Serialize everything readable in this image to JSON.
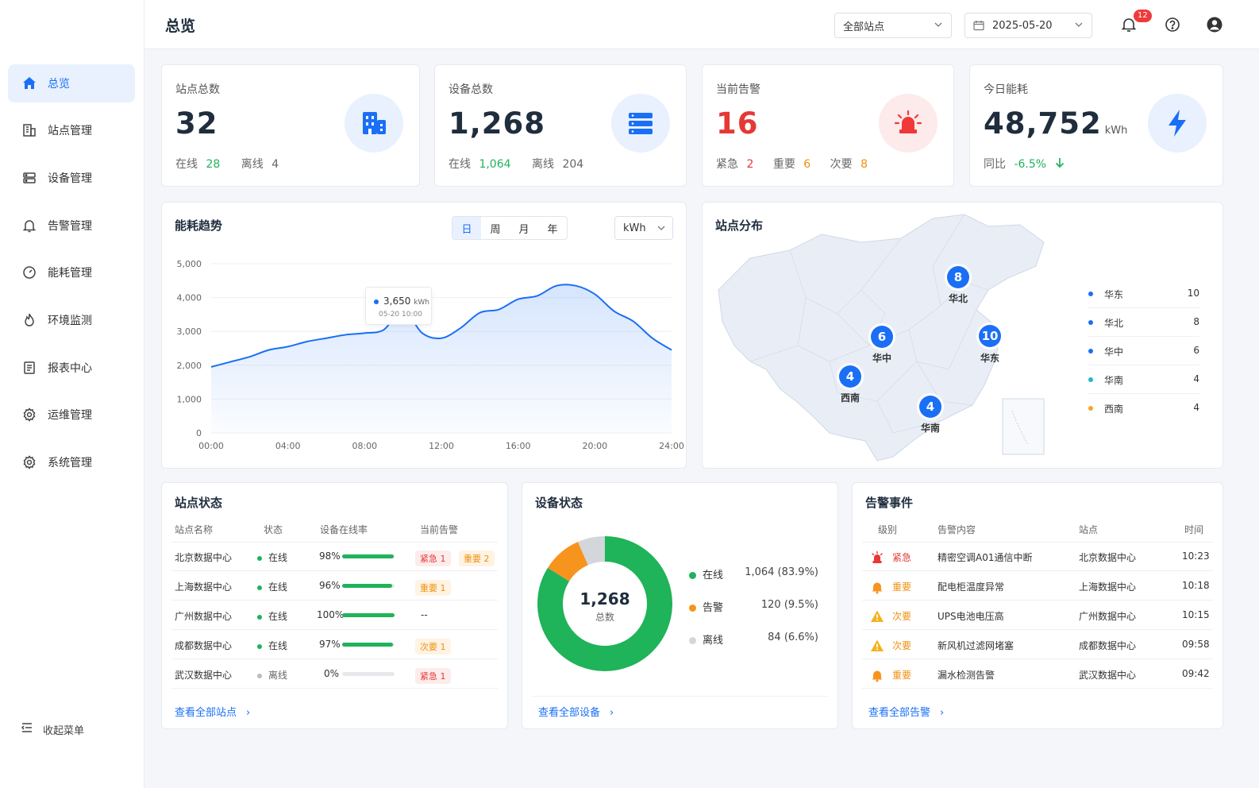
{
  "nav": {
    "items": [
      {
        "label": "总览",
        "icon": "home-icon"
      },
      {
        "label": "站点管理",
        "icon": "building-icon"
      },
      {
        "label": "设备管理",
        "icon": "server-icon"
      },
      {
        "label": "告警管理",
        "icon": "bell-icon"
      },
      {
        "label": "能耗管理",
        "icon": "gauge-icon"
      },
      {
        "label": "环境监测",
        "icon": "flame-icon"
      },
      {
        "label": "报表中心",
        "icon": "report-icon"
      },
      {
        "label": "运维管理",
        "icon": "settings-icon"
      },
      {
        "label": "系统管理",
        "icon": "settings-icon"
      }
    ],
    "collapse_label": "收起菜单"
  },
  "header": {
    "title": "总览",
    "site_select": "全部站点",
    "date": "2025-05-20",
    "notification_count": "12"
  },
  "stats": {
    "sites": {
      "label": "站点总数",
      "value": "32",
      "online_label": "在线",
      "online": "28",
      "offline_label": "离线",
      "offline": "4"
    },
    "devices": {
      "label": "设备总数",
      "value": "1,268",
      "online_label": "在线",
      "online": "1,064",
      "offline_label": "离线",
      "offline": "204"
    },
    "alarms": {
      "label": "当前告警",
      "value": "16",
      "urgent_label": "紧急",
      "urgent": "2",
      "major_label": "重要",
      "major": "6",
      "minor_label": "次要",
      "minor": "8"
    },
    "energy": {
      "label": "今日能耗",
      "value": "48,752",
      "unit": "kWh",
      "yoy_label": "同比",
      "yoy": "-6.5%"
    }
  },
  "energy_trend": {
    "title": "能耗趋势",
    "tabs": [
      "日",
      "周",
      "月",
      "年"
    ],
    "unit_select": "kWh",
    "tooltip_value": "3,650",
    "tooltip_unit": "kWh",
    "tooltip_time": "05-20 10:00"
  },
  "chart_data": {
    "type": "area",
    "x": [
      "00:00",
      "01:00",
      "02:00",
      "03:00",
      "04:00",
      "05:00",
      "06:00",
      "07:00",
      "08:00",
      "09:00",
      "10:00",
      "11:00",
      "12:00",
      "13:00",
      "14:00",
      "15:00",
      "16:00",
      "17:00",
      "18:00",
      "19:00",
      "20:00",
      "21:00",
      "22:00",
      "23:00",
      "24:00"
    ],
    "series": [
      {
        "values": [
          1950,
          2100,
          2250,
          2450,
          2550,
          2700,
          2800,
          2900,
          2950,
          3050,
          3650,
          2950,
          2800,
          3100,
          3550,
          3650,
          3950,
          4050,
          4350,
          4350,
          4100,
          3600,
          3300,
          2800,
          2450
        ]
      }
    ],
    "ylim": [
      0,
      5000
    ],
    "yticks": [
      "5,000",
      "4,000",
      "3,000",
      "2,000",
      "1,000",
      "0"
    ],
    "xticks": [
      "00:00",
      "04:00",
      "08:00",
      "12:00",
      "16:00",
      "20:00",
      "24:00"
    ],
    "grid": true
  },
  "site_map": {
    "title": "站点分布",
    "pins": [
      {
        "value": "8",
        "label": "华北"
      },
      {
        "value": "6",
        "label": "华中"
      },
      {
        "value": "10",
        "label": "华东"
      },
      {
        "value": "4",
        "label": "西南"
      },
      {
        "value": "4",
        "label": "华南"
      }
    ],
    "legend": [
      {
        "label": "华东",
        "value": "10",
        "color": "#1a6ff5"
      },
      {
        "label": "华北",
        "value": "8",
        "color": "#1a6ff5"
      },
      {
        "label": "华中",
        "value": "6",
        "color": "#1a6ff5"
      },
      {
        "label": "华南",
        "value": "4",
        "color": "#22b8cf"
      },
      {
        "label": "西南",
        "value": "4",
        "color": "#f5a623"
      }
    ]
  },
  "site_status": {
    "title": "站点状态",
    "columns": [
      "站点名称",
      "状态",
      "设备在线率",
      "当前告警"
    ],
    "rows": [
      {
        "name": "北京数据中心",
        "status": "在线",
        "rate": "98%",
        "rate_value": 98,
        "tags": [
          {
            "text": "紧急 1",
            "level": "red"
          },
          {
            "text": "重要 2",
            "level": "orange"
          }
        ]
      },
      {
        "name": "上海数据中心",
        "status": "在线",
        "rate": "96%",
        "rate_value": 96,
        "tags": [
          {
            "text": "重要 1",
            "level": "orange"
          }
        ]
      },
      {
        "name": "广州数据中心",
        "status": "在线",
        "rate": "100%",
        "rate_value": 100,
        "tags": [
          {
            "text": "--",
            "level": "none"
          }
        ]
      },
      {
        "name": "成都数据中心",
        "status": "在线",
        "rate": "97%",
        "rate_value": 97,
        "tags": [
          {
            "text": "次要 1",
            "level": "orange"
          }
        ]
      },
      {
        "name": "武汉数据中心",
        "status": "离线",
        "rate": "0%",
        "rate_value": 0,
        "tags": [
          {
            "text": "紧急 1",
            "level": "red"
          }
        ]
      }
    ],
    "link": "查看全部站点"
  },
  "device_status": {
    "title": "设备状态",
    "center_value": "1,268",
    "center_label": "总数",
    "segments": [
      {
        "label": "在线",
        "value": "1,064 (83.9%)",
        "percent": 83.9,
        "color": "#1fb35a"
      },
      {
        "label": "告警",
        "value": "120 (9.5%)",
        "percent": 9.5,
        "color": "#f7941d"
      },
      {
        "label": "离线",
        "value": "84 (6.6%)",
        "percent": 6.6,
        "color": "#d3d6db"
      }
    ],
    "link": "查看全部设备"
  },
  "alarm_events": {
    "title": "告警事件",
    "columns": [
      "级别",
      "告警内容",
      "站点",
      "时间"
    ],
    "rows": [
      {
        "level": "紧急",
        "type": "urgent",
        "content": "精密空调A01通信中断",
        "site": "北京数据中心",
        "time": "10:23"
      },
      {
        "level": "重要",
        "type": "major",
        "content": "配电柜温度异常",
        "site": "上海数据中心",
        "time": "10:18"
      },
      {
        "level": "次要",
        "type": "minor",
        "content": "UPS电池电压高",
        "site": "广州数据中心",
        "time": "10:15"
      },
      {
        "level": "次要",
        "type": "minor",
        "content": "新风机过滤网堵塞",
        "site": "成都数据中心",
        "time": "09:58"
      },
      {
        "level": "重要",
        "type": "major",
        "content": "漏水检测告警",
        "site": "武汉数据中心",
        "time": "09:42"
      }
    ],
    "link": "查看全部告警"
  }
}
